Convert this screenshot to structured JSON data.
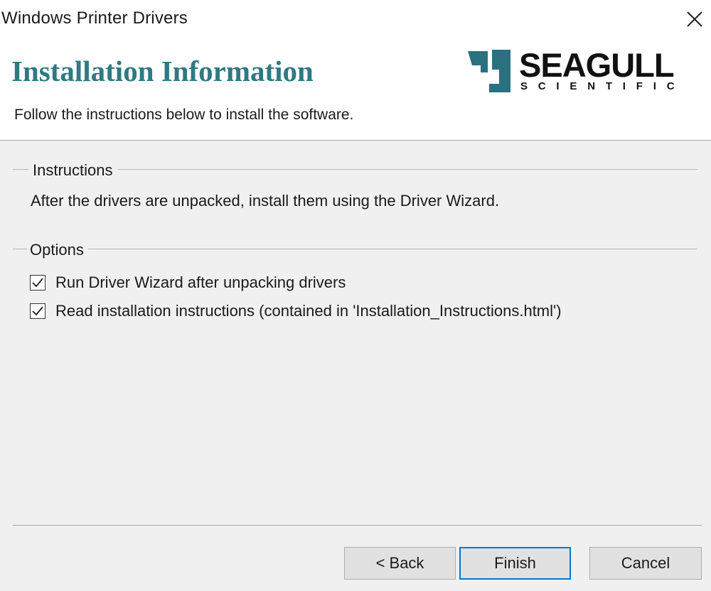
{
  "window": {
    "title": "Windows Printer Drivers",
    "close_icon": "close-icon"
  },
  "header": {
    "heading": "Installation Information",
    "subheading": "Follow the instructions below to install the software.",
    "heading_color": "#2e7a82"
  },
  "logo": {
    "word": "SEAGULL",
    "sub": "SCIENTIFIC",
    "mark_color": "#2a7080"
  },
  "instructions": {
    "label": "Instructions",
    "text": "After the drivers are unpacked, install them using the Driver Wizard."
  },
  "options": {
    "label": "Options",
    "items": [
      {
        "label": "Run Driver Wizard after unpacking drivers",
        "checked": true
      },
      {
        "label": "Read installation instructions (contained in 'Installation_Instructions.html')",
        "checked": true
      }
    ]
  },
  "buttons": {
    "back": "< Back",
    "finish": "Finish",
    "cancel": "Cancel",
    "accent": "#0078d7"
  }
}
